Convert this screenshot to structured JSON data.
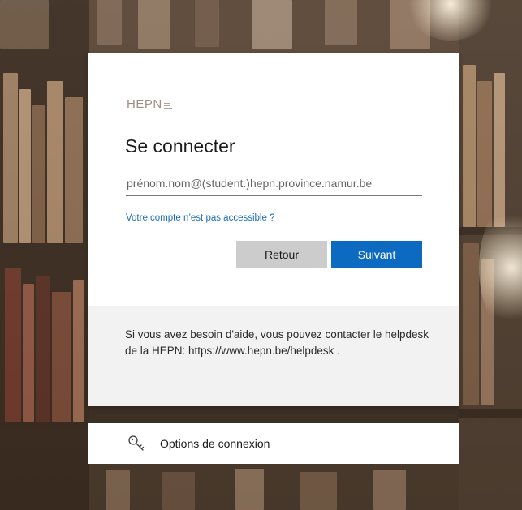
{
  "logo": {
    "text": "HEPN"
  },
  "login": {
    "title": "Se connecter",
    "email_placeholder": "prénom.nom@(student.)hepn.province.namur.be",
    "help_link": "Votre compte n’est pas accessible ?",
    "back_label": "Retour",
    "next_label": "Suivant"
  },
  "footer": {
    "help_text": "Si vous avez besoin d'aide, vous pouvez contacter le helpdesk de la HEPN: https://www.hepn.be/helpdesk ."
  },
  "options": {
    "label": "Options de connexion",
    "icon": "key-icon"
  },
  "colors": {
    "primary": "#0c6ac0",
    "link": "#1a6db8",
    "secondary_button": "#cccccc",
    "footer_bg": "#f2f2f2"
  }
}
